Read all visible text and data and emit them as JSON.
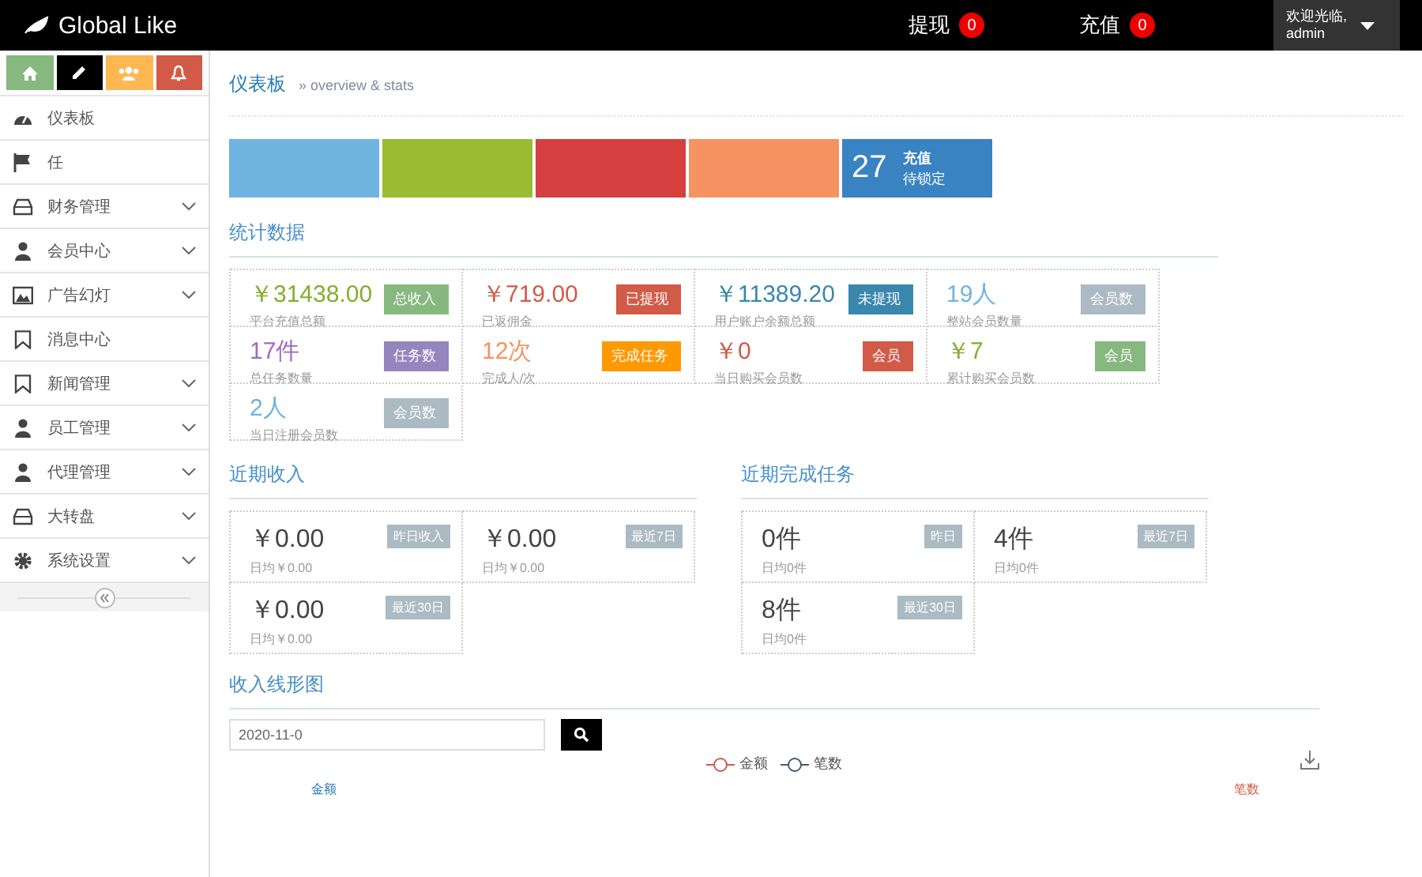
{
  "header": {
    "brand": "Global Like",
    "notices": [
      {
        "label": "提现",
        "count": "0"
      },
      {
        "label": "充值",
        "count": "0"
      }
    ],
    "user": {
      "greeting": "欢迎光临,",
      "name": "admin"
    }
  },
  "shortcuts": [
    {
      "color": "#87b87f"
    },
    {
      "color": "#000000"
    },
    {
      "color": "#ffb752"
    },
    {
      "color": "#d15b47"
    }
  ],
  "sidebar": {
    "items": [
      {
        "label": "仪表板",
        "expandable": false
      },
      {
        "label": "任",
        "expandable": false
      },
      {
        "label": "财务管理",
        "expandable": true
      },
      {
        "label": "会员中心",
        "expandable": true
      },
      {
        "label": "广告幻灯",
        "expandable": true
      },
      {
        "label": "消息中心",
        "expandable": false
      },
      {
        "label": "新闻管理",
        "expandable": true
      },
      {
        "label": "员工管理",
        "expandable": true
      },
      {
        "label": "代理管理",
        "expandable": true
      },
      {
        "label": "大转盘",
        "expandable": true
      },
      {
        "label": "系统设置",
        "expandable": true
      }
    ]
  },
  "breadcrumb": {
    "title": "仪表板",
    "subtitle": "» overview & stats"
  },
  "tiles": [
    {
      "color": "#6fb3e0"
    },
    {
      "color": "#9abc32"
    },
    {
      "color": "#d53f40"
    },
    {
      "color": "#f79263"
    },
    {
      "color": "#3983c2",
      "number": "27",
      "title": "充值",
      "subtitle": "待锁定"
    }
  ],
  "stats": {
    "title": "统计数据",
    "items": [
      {
        "value": "￥31438.00",
        "label": "平台充值总额",
        "color": "#82af2f",
        "tag": {
          "label": "总收入",
          "color": "#87b87f"
        }
      },
      {
        "value": "￥719.00",
        "label": "已返佣金",
        "color": "#d15b47",
        "tag": {
          "label": "已提现",
          "color": "#d15b47"
        }
      },
      {
        "value": "￥11389.20",
        "label": "用户账户余额总额",
        "color": "#3a87ad",
        "tag": {
          "label": "未提现",
          "color": "#3a87ad"
        }
      },
      {
        "value": "19人",
        "label": "整站会员数量",
        "color": "#6fb3e0",
        "tag": {
          "label": "会员数",
          "color": "#abbac3"
        }
      },
      {
        "value": "17件",
        "label": "总任务数量",
        "color": "#a069c3",
        "tag": {
          "label": "任务数",
          "color": "#9585bf"
        }
      },
      {
        "value": "12次",
        "label": "完成人/次",
        "color": "#f79263",
        "tag": {
          "label": "完成任务",
          "color": "#ff9900"
        }
      },
      {
        "value": "￥0",
        "label": "当日购买会员数",
        "color": "#d15b47",
        "tag": {
          "label": "会员",
          "color": "#d15b47"
        }
      },
      {
        "value": "￥7",
        "label": "累计购买会员数",
        "color": "#82af2f",
        "tag": {
          "label": "会员",
          "color": "#87b87f"
        }
      },
      {
        "value": "2人",
        "label": "当日注册会员数",
        "color": "#6fb3e0",
        "tag": {
          "label": "会员数",
          "color": "#abbac3"
        }
      }
    ]
  },
  "recent_income": {
    "title": "近期收入",
    "items": [
      {
        "value": "￥0.00",
        "label": "日均￥0.00",
        "tag": "昨日收入"
      },
      {
        "value": "￥0.00",
        "label": "日均￥0.00",
        "tag": "最近7日"
      },
      {
        "value": "￥0.00",
        "label": "日均￥0.00",
        "tag": "最近30日"
      }
    ]
  },
  "recent_tasks": {
    "title": "近期完成任务",
    "items": [
      {
        "value": "0件",
        "label": "日均0件",
        "tag": "昨日"
      },
      {
        "value": "4件",
        "label": "日均0件",
        "tag": "最近7日"
      },
      {
        "value": "8件",
        "label": "日均0件",
        "tag": "最近30日"
      }
    ]
  },
  "income_chart": {
    "title": "收入线形图",
    "date_value": "2020-11-0",
    "legend": [
      {
        "label": "金额",
        "color": "#d15b47"
      },
      {
        "label": "笔数",
        "color": "#4a5a6a"
      }
    ],
    "left_axis": "金额",
    "right_axis": "笔数"
  }
}
